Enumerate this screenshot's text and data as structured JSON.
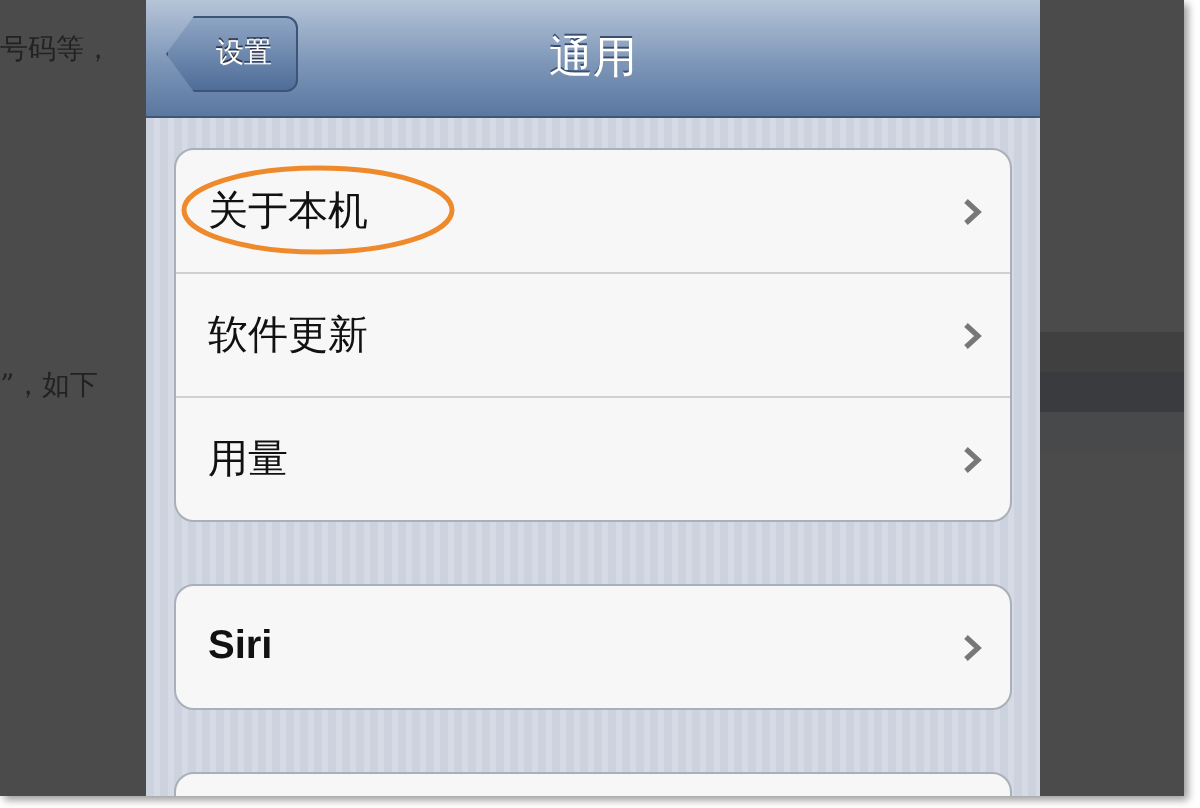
{
  "background_text": [
    "号码等，",
    "”，如下"
  ],
  "nav_bar": {
    "back_button": "设置",
    "title": "通用"
  },
  "groups": [
    {
      "items": [
        {
          "label": "关于本机",
          "highlighted": true
        },
        {
          "label": "软件更新",
          "highlighted": false
        },
        {
          "label": "用量",
          "highlighted": false
        }
      ]
    },
    {
      "items": [
        {
          "label": "Siri",
          "highlighted": false
        }
      ]
    }
  ]
}
